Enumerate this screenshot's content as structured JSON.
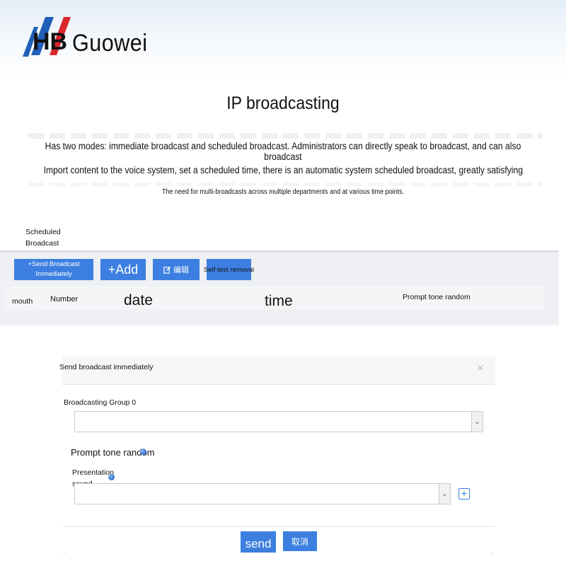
{
  "brand": {
    "name": "Guowei",
    "logo_text": "HB",
    "colors": {
      "red": "#d8262c",
      "blue": "#1f5fb8",
      "dark": "#111111"
    }
  },
  "page": {
    "title": "IP broadcasting",
    "description": [
      "Has two modes: immediate broadcast and scheduled broadcast. Administrators can directly speak to broadcast, and can also broadcast",
      "Import content to the voice system, set a scheduled time, there is an automatic system scheduled broadcast, greatly satisfying",
      "The need for multi-broadcasts across multiple departments and at various time points."
    ]
  },
  "schedule_panel": {
    "label": "Scheduled Broadcast",
    "toolbar": {
      "send_now_label": "+Send Broadcast Immediately",
      "add_label": "+Add",
      "edit_label": "编辑",
      "self_test_label": "Self-test removal"
    },
    "table_headers": [
      "mouth",
      "Number",
      "date",
      "time",
      "Prompt tone random"
    ]
  },
  "modal": {
    "title": "Send broadcast immediately",
    "close_glyph": "×",
    "group_label": "Broadcasting Group 0",
    "group_value": "",
    "prompt_label": "Prompt tone random",
    "presentation_label": "Presentation sound",
    "presentation_value": "",
    "send_label": "send",
    "cancel_label": "取消"
  },
  "accent_color": "#3c7fe0",
  "icons": [
    "edit-icon",
    "close-icon",
    "chevron-down-icon",
    "plus-square-icon",
    "toggle-dot-icon"
  ]
}
